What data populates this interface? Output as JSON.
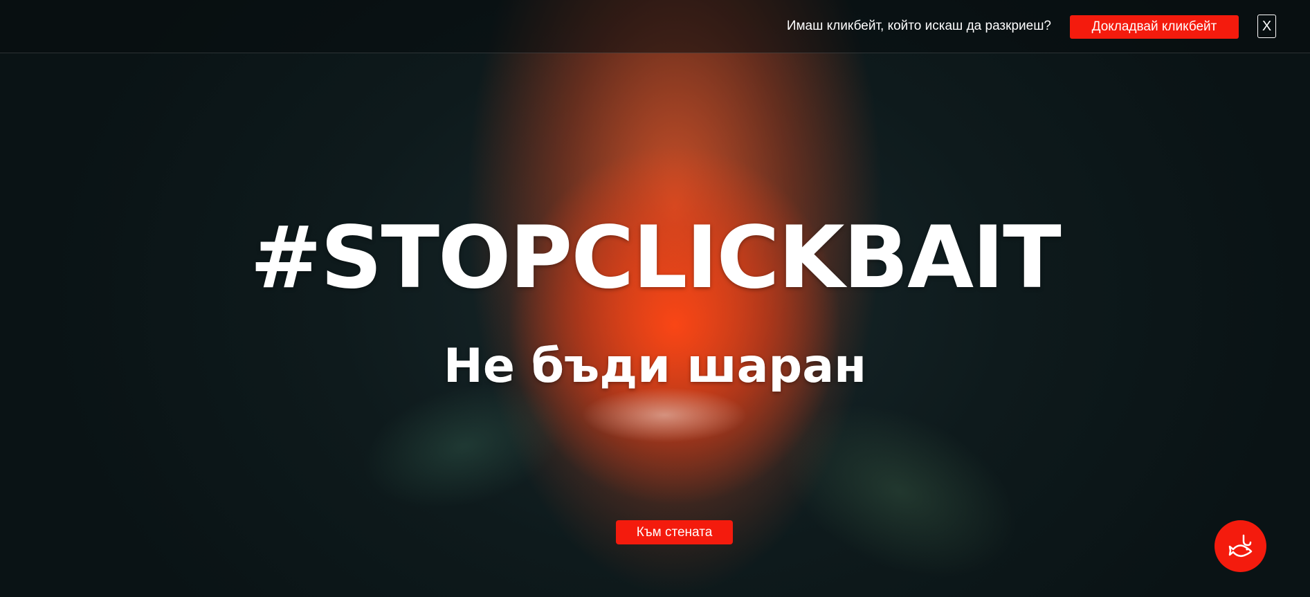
{
  "top_bar": {
    "prompt_text": "Имаш кликбейт, който искаш да разкриеш?",
    "report_button_label": "Докладвай кликбейт",
    "close_label": "X"
  },
  "hero": {
    "title": "#STOPCLICKBAIT",
    "subtitle": "Не бъди шаран",
    "wall_button_label": "Към стената"
  },
  "fab": {
    "icon": "fish-hook-icon"
  },
  "colors": {
    "accent": "#f41b0d",
    "text": "#ffffff",
    "background": "#0c1719"
  }
}
